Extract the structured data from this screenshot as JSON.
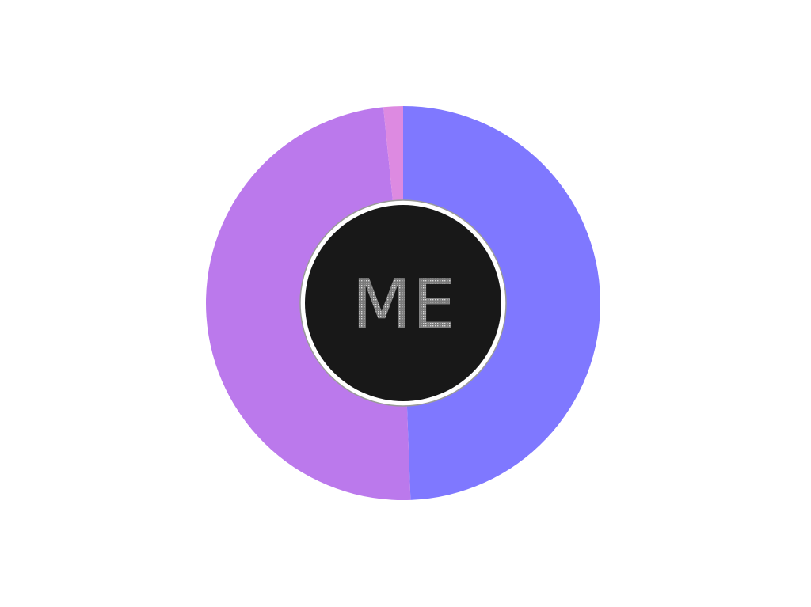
{
  "chart_data": {
    "type": "pie",
    "variant": "donut",
    "title": "",
    "slices": [
      {
        "value": 49.4,
        "color": "#7f78ff"
      },
      {
        "value": 49.0,
        "color": "#bb79ec"
      },
      {
        "value": 1.6,
        "color": "#dd8ae1"
      }
    ],
    "start_angle_deg": 0,
    "direction": "clockwise",
    "legend": "none"
  },
  "center_badge": {
    "text": "ME",
    "background": "#181818",
    "ring_color": "#ffffff",
    "text_color": "#8a8a8a"
  }
}
